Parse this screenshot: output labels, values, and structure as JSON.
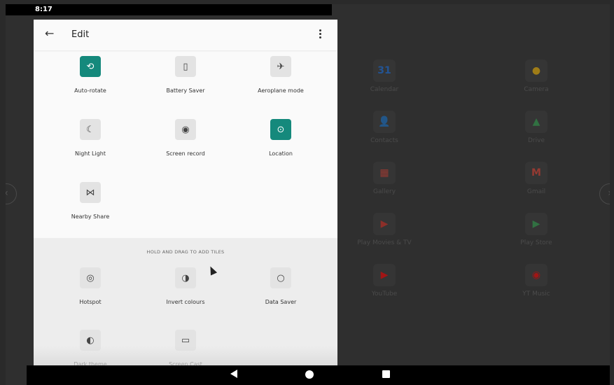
{
  "status_bar": {
    "time": "8:17"
  },
  "header": {
    "title": "Edit"
  },
  "active_tiles": [
    {
      "label": "Auto-rotate",
      "icon": "auto-rotate-icon",
      "glyph": "⟲",
      "on": true
    },
    {
      "label": "Battery Saver",
      "icon": "battery-saver-icon",
      "glyph": "▯",
      "on": false
    },
    {
      "label": "Aeroplane mode",
      "icon": "airplane-icon",
      "glyph": "✈",
      "on": false
    },
    {
      "label": "Night Light",
      "icon": "night-light-icon",
      "glyph": "☾",
      "on": false
    },
    {
      "label": "Screen record",
      "icon": "screen-record-icon",
      "glyph": "◉",
      "on": false
    },
    {
      "label": "Location",
      "icon": "location-icon",
      "glyph": "⊙",
      "on": true
    },
    {
      "label": "Nearby Share",
      "icon": "nearby-share-icon",
      "glyph": "⋈",
      "on": false
    }
  ],
  "available_section": {
    "hint": "HOLD AND DRAG TO ADD TILES",
    "tiles": [
      {
        "label": "Hotspot",
        "icon": "hotspot-icon",
        "glyph": "◎"
      },
      {
        "label": "Invert colours",
        "icon": "invert-colours-icon",
        "glyph": "◑"
      },
      {
        "label": "Data Saver",
        "icon": "data-saver-icon",
        "glyph": "○"
      },
      {
        "label": "Dark theme",
        "icon": "dark-theme-icon",
        "glyph": "◐"
      },
      {
        "label": "Screen Cast",
        "icon": "screen-cast-icon",
        "glyph": "▭"
      }
    ]
  },
  "background_apps": [
    {
      "label": "Calendar",
      "icon": "calendar-icon",
      "glyph": "31",
      "color": "#1a73e8"
    },
    {
      "label": "Camera",
      "icon": "camera-icon",
      "glyph": "●",
      "color": "#fbbc04"
    },
    {
      "label": "Contacts",
      "icon": "contacts-icon",
      "glyph": "👤",
      "color": "#1a73e8"
    },
    {
      "label": "Drive",
      "icon": "drive-icon",
      "glyph": "▲",
      "color": "#34a853"
    },
    {
      "label": "Gallery",
      "icon": "gallery-icon",
      "glyph": "▦",
      "color": "#ea4335"
    },
    {
      "label": "Gmail",
      "icon": "gmail-icon",
      "glyph": "M",
      "color": "#ea4335"
    },
    {
      "label": "Play Movies & TV",
      "icon": "play-movies-icon",
      "glyph": "▶",
      "color": "#d93025"
    },
    {
      "label": "Play Store",
      "icon": "play-store-icon",
      "glyph": "▶",
      "color": "#34a853"
    },
    {
      "label": "YouTube",
      "icon": "youtube-icon",
      "glyph": "▶",
      "color": "#ff0000"
    },
    {
      "label": "YT Music",
      "icon": "yt-music-icon",
      "glyph": "◉",
      "color": "#ff0000"
    }
  ]
}
